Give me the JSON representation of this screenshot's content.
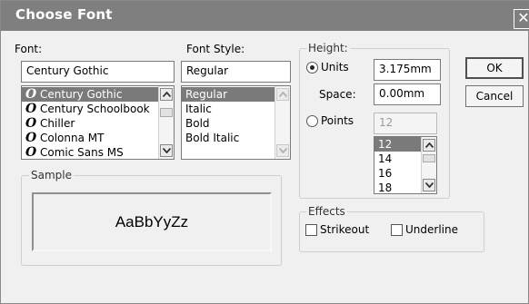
{
  "window": {
    "title": "Choose Font",
    "close_glyph": "✕"
  },
  "font": {
    "label": "Font:",
    "value": "Century Gothic",
    "items": [
      {
        "glyph": "O",
        "label": "Century Gothic"
      },
      {
        "glyph": "O",
        "label": "Century Schoolbook"
      },
      {
        "glyph": "O",
        "label": "Chiller"
      },
      {
        "glyph": "O",
        "label": "Colonna MT"
      },
      {
        "glyph": "O",
        "label": "Comic Sans MS"
      }
    ],
    "selected_index": 0
  },
  "font_style": {
    "label": "Font Style:",
    "value": "Regular",
    "items": [
      "Regular",
      "Italic",
      "Bold",
      "Bold Italic"
    ],
    "selected_index": 0
  },
  "height": {
    "group_label": "Height:",
    "units_label": "Units",
    "units_value": "3.175mm",
    "space_label": "Space:",
    "space_value": "0.00mm",
    "points_label": "Points",
    "points_value": "12",
    "points_items": [
      "12",
      "14",
      "16",
      "18"
    ],
    "points_selected_index": 0,
    "selected_option": "Units"
  },
  "effects": {
    "group_label": "Effects",
    "strikeout_label": "Strikeout",
    "strikeout_checked": false,
    "underline_label": "Underline",
    "underline_checked": false
  },
  "sample": {
    "group_label": "Sample",
    "text": "AaBbYyZz"
  },
  "buttons": {
    "ok": "OK",
    "cancel": "Cancel"
  },
  "colors": {
    "titlebar": "#7f7f7f",
    "dialog": "#f0f0f0",
    "selection": "#7a7a7a"
  },
  "icons": {
    "scroll_up": "chevron-up-icon",
    "scroll_down": "chevron-down-icon",
    "font_type": "opentype-font-icon",
    "close": "close-icon"
  }
}
